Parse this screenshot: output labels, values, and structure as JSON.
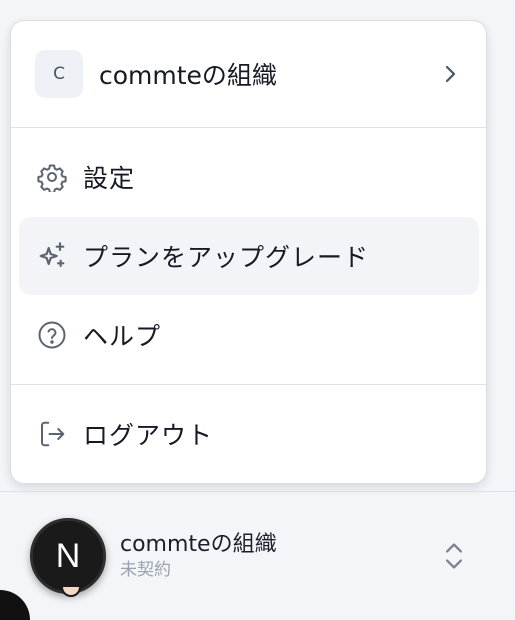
{
  "menu": {
    "org": {
      "initial": "C",
      "name": "commteの組織",
      "chevron_icon": "chevron-right-icon"
    },
    "items": [
      {
        "label": "設定",
        "icon": "gear-icon"
      },
      {
        "label": "プランをアップグレード",
        "icon": "sparkles-icon",
        "highlighted": true
      },
      {
        "label": "ヘルプ",
        "icon": "help-circle-icon"
      },
      {
        "label": "ログアウト",
        "icon": "logout-icon"
      }
    ]
  },
  "switcher": {
    "avatar_letter": "N",
    "org_name": "commteの組織",
    "status": "未契約",
    "toggle_icon": "chevrons-up-down-icon"
  },
  "colors": {
    "menu_bg": "#ffffff",
    "hover_bg": "#f2f4f7",
    "page_bg": "#f3f5f8",
    "text": "#161a24",
    "muted": "#9aa2b1",
    "icon": "#5b6472"
  }
}
